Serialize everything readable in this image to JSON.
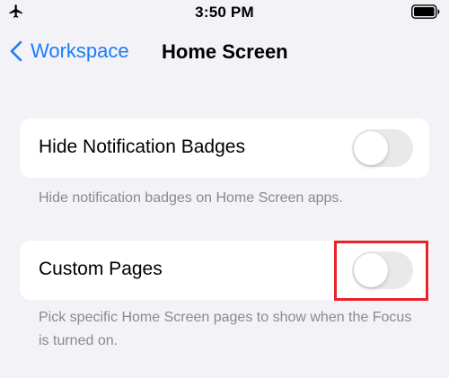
{
  "status_bar": {
    "time": "3:50 PM",
    "left_icon": "airplane-icon",
    "right_icon": "battery-icon"
  },
  "nav": {
    "back_label": "Workspace",
    "back_icon": "chevron-left-icon",
    "title": "Home Screen",
    "accent_color": "#1a7cf5"
  },
  "settings": [
    {
      "label": "Hide Notification Badges",
      "enabled": false,
      "footer": "Hide notification badges on Home Screen apps."
    },
    {
      "label": "Custom Pages",
      "enabled": false,
      "footer": "Pick specific Home Screen pages to show when the Focus is turned on."
    }
  ],
  "highlight_color": "#e8232a"
}
